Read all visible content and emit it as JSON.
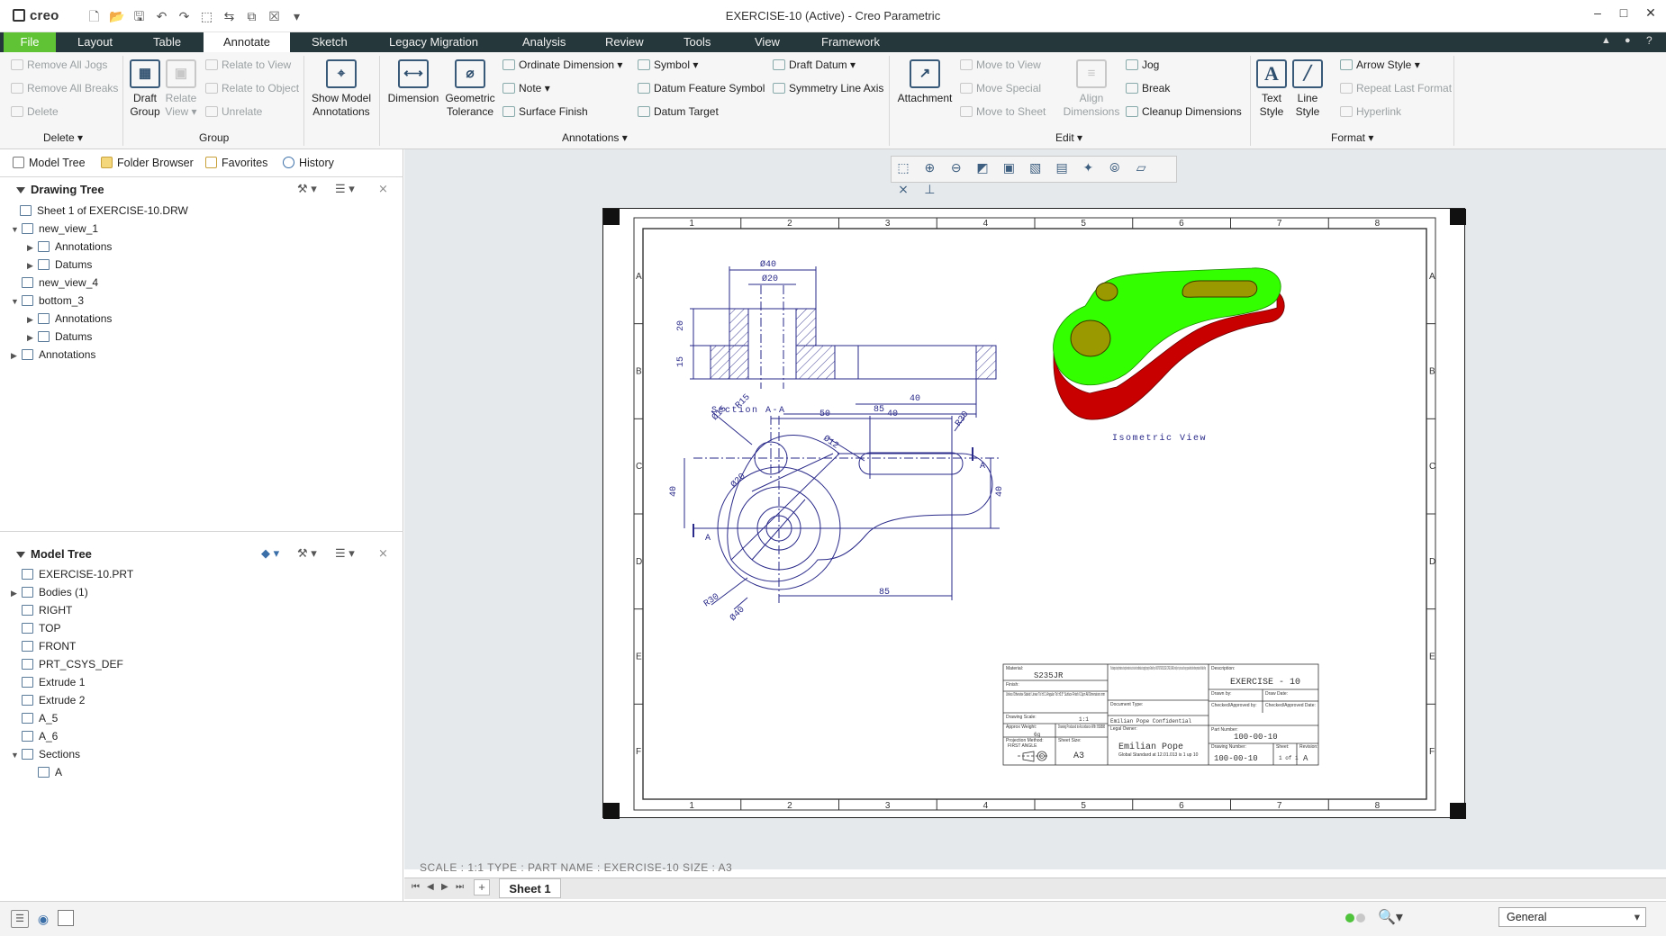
{
  "window": {
    "app": "creo",
    "title": "EXERCISE-10 (Active) - Creo Parametric",
    "minimize": "–",
    "maximize": "□",
    "close": "✕"
  },
  "menu_tabs": [
    "File",
    "Layout",
    "Table",
    "Annotate",
    "Sketch",
    "Legacy Migration",
    "Analysis",
    "Review",
    "Tools",
    "View",
    "Framework"
  ],
  "ribbon": {
    "delete_group": {
      "remove_all_jogs": "Remove All Jogs",
      "remove_all_breaks": "Remove All Breaks",
      "delete": "Delete",
      "label": "Delete"
    },
    "group_group": {
      "draft_group_1": "Draft",
      "draft_group_2": "Group",
      "relate_view_1": "Relate",
      "relate_view_2": "View",
      "relate_to_view": "Relate to View",
      "relate_to_object": "Relate to Object",
      "unrelate": "Unrelate",
      "label": "Group"
    },
    "show_model_annotations_1": "Show Model",
    "show_model_annotations_2": "Annotations",
    "annotations_group": {
      "dimension": "Dimension",
      "geometric_1": "Geometric",
      "geometric_2": "Tolerance",
      "ordinate_dimension": "Ordinate Dimension",
      "note": "Note",
      "surface_finish": "Surface Finish",
      "symbol": "Symbol",
      "datum_feature_symbol": "Datum Feature Symbol",
      "datum_target": "Datum Target",
      "draft_datum": "Draft Datum",
      "symmetry_line_axis": "Symmetry Line Axis",
      "label": "Annotations"
    },
    "edit_group": {
      "attachment": "Attachment",
      "move_to_view": "Move to View",
      "move_special": "Move Special",
      "move_to_sheet": "Move to Sheet",
      "align_1": "Align",
      "align_2": "Dimensions",
      "jog": "Jog",
      "break": "Break",
      "cleanup_dimensions": "Cleanup Dimensions",
      "label": "Edit"
    },
    "format_group": {
      "text_style_1": "Text",
      "text_style_2": "Style",
      "line_style_1": "Line",
      "line_style_2": "Style",
      "arrow_style": "Arrow Style",
      "repeat_last_format": "Repeat Last Format",
      "hyperlink": "Hyperlink",
      "label": "Format"
    }
  },
  "panel_tabs": [
    "Model Tree",
    "Folder Browser",
    "Favorites",
    "History"
  ],
  "drawing_tree": {
    "title": "Drawing Tree",
    "rows": [
      {
        "label": "Sheet 1 of EXERCISE-10.DRW",
        "toggle": ""
      },
      {
        "label": "new_view_1",
        "toggle": "▼"
      },
      {
        "label": "Annotations",
        "toggle": "▶"
      },
      {
        "label": "Datums",
        "toggle": "▶"
      },
      {
        "label": "new_view_4",
        "toggle": ""
      },
      {
        "label": "bottom_3",
        "toggle": "▼"
      },
      {
        "label": "Annotations",
        "toggle": "▶"
      },
      {
        "label": "Datums",
        "toggle": "▶"
      },
      {
        "label": "Annotations",
        "toggle": "▶"
      }
    ]
  },
  "model_tree": {
    "title": "Model Tree",
    "rows": [
      {
        "label": "EXERCISE-10.PRT",
        "toggle": ""
      },
      {
        "label": "Bodies (1)",
        "toggle": "▶"
      },
      {
        "label": "RIGHT",
        "toggle": ""
      },
      {
        "label": "TOP",
        "toggle": ""
      },
      {
        "label": "FRONT",
        "toggle": ""
      },
      {
        "label": "PRT_CSYS_DEF",
        "toggle": ""
      },
      {
        "label": "Extrude 1",
        "toggle": ""
      },
      {
        "label": "Extrude 2",
        "toggle": ""
      },
      {
        "label": "A_5",
        "toggle": ""
      },
      {
        "label": "A_6",
        "toggle": ""
      },
      {
        "label": "Sections",
        "toggle": "▼"
      },
      {
        "label": "A",
        "toggle": ""
      }
    ]
  },
  "drawing": {
    "col_labels": [
      "1",
      "2",
      "3",
      "4",
      "5",
      "6",
      "7",
      "8"
    ],
    "row_labels": [
      "A",
      "B",
      "C",
      "D",
      "E",
      "F"
    ],
    "section_label": "Section A-A",
    "iso_label": "Isometric View",
    "dims": {
      "d40": "Ø40",
      "d20": "Ø20",
      "v20": "20",
      "v15": "15",
      "h40": "40",
      "h85": "85",
      "h50": "50",
      "h40b": "40",
      "r15": "R15",
      "d15": "Ø15",
      "r30": "R30",
      "d12": "Ø12",
      "d20b": "Ø20",
      "v40l": "40",
      "v40r": "40",
      "r30b": "R30",
      "d40b": "Ø40",
      "h85b": "85",
      "sa": "A",
      "sa2": "A"
    },
    "title_block": {
      "material_lbl": "Material:",
      "material": "S235JR",
      "finish_lbl": "Finish:",
      "notes": "Unless Otherwise Stated: Linear Tol ±0.1 Angular Tol ±0.5° Surface Finish 6.3µm All Dimensions mm",
      "scale_lbl": "Drawing Scale:",
      "scale": "1:1",
      "weight_lbl": "Approx Weight:",
      "weight": "6g",
      "produced": "Drawing Produced to Accordance With: BS8888",
      "proj_lbl": "Projection Method:",
      "proj": "FIRST ANGLE",
      "size_lbl": "Sheet Size:",
      "size": "A3",
      "conf_text": "This drawing and any information or descriptive matter set out on it are the confidential and copyright property of Emilian Pope. It MUST NOT BE DISCLOSED, COPIED, LOANED or wholly or in part or used for any purpose without the written permission of Emilian Pope",
      "doc_type_lbl": "Document Type:",
      "conf": "Emilian Pope Confidential",
      "legal_lbl": "Legal Owner:",
      "owner": "Emilian Pope",
      "owner_sub": "Global Standard at 12.01.013 is 1 up 10",
      "desc_lbl": "Description:",
      "desc": "EXERCISE - 10",
      "drawn_lbl": "Drawn by:",
      "draw_date_lbl": "Draw Date:",
      "checked_lbl": "Checked/Approved by:",
      "checked_date_lbl": "Checked/Approved Date:",
      "part_lbl": "Part Number:",
      "part": "100-00-10",
      "dwg_lbl": "Drawing Number:",
      "dwg": "100-00-10",
      "sheet_lbl": "Sheet:",
      "sheet": "1 of 1",
      "rev_lbl": "Revision:",
      "rev": "A"
    }
  },
  "status_info": "SCALE : 1:1     TYPE : PART     NAME : EXERCISE-10     SIZE : A3",
  "sheet_tab": "Sheet 1",
  "filter": "General",
  "colors": {
    "menubar": "#25373a",
    "file_tab": "#5fc335",
    "part_green": "#33ff00",
    "part_red": "#c80000",
    "hole_yellow": "#9a9a00",
    "drawing_line": "#2a2a8a"
  }
}
